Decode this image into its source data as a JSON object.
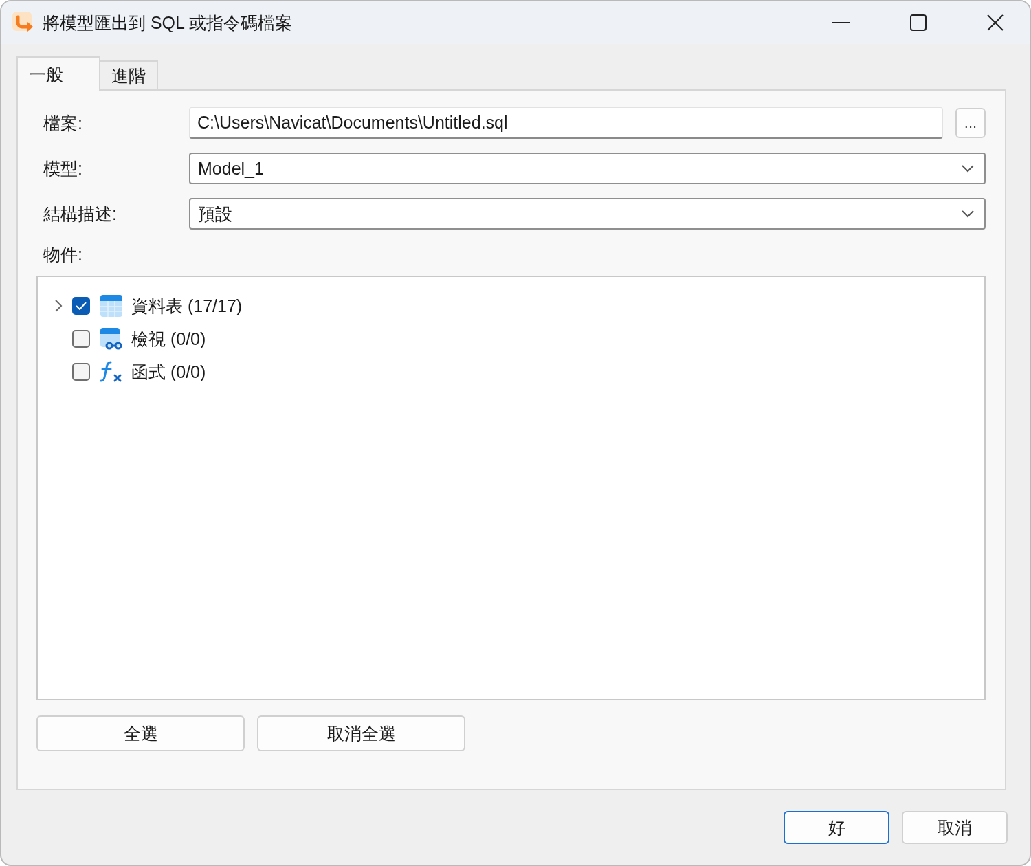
{
  "window": {
    "title": "將模型匯出到 SQL 或指令碼檔案"
  },
  "tabs": [
    {
      "label": "一般",
      "selected": true
    },
    {
      "label": "進階",
      "selected": false
    }
  ],
  "form": {
    "file": {
      "label": "檔案:",
      "value": "C:\\Users\\Navicat\\Documents\\Untitled.sql",
      "browse": "..."
    },
    "model": {
      "label": "模型:",
      "value": "Model_1"
    },
    "schema": {
      "label": "結構描述:",
      "value": "預設"
    },
    "objects_label": "物件:"
  },
  "objects": [
    {
      "kind": "table",
      "label": "資料表 (17/17)",
      "checked": true,
      "expandable": true
    },
    {
      "kind": "view",
      "label": "檢視 (0/0)",
      "checked": false,
      "expandable": false
    },
    {
      "kind": "function",
      "label": "函式 (0/0)",
      "checked": false,
      "expandable": false
    }
  ],
  "select_buttons": [
    "全選",
    "取消全選"
  ],
  "dialog_buttons": [
    {
      "label": "好",
      "default": true
    },
    {
      "label": "取消",
      "default": false
    }
  ]
}
